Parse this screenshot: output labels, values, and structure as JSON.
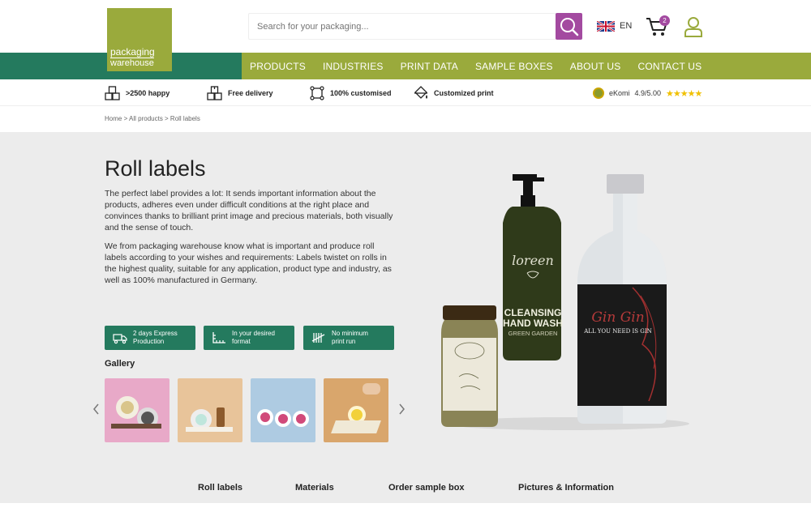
{
  "header": {
    "logo_line1": "packaging",
    "logo_line2": "warehouse",
    "search_placeholder": "Search for your packaging...",
    "language": "EN",
    "cart_count": "2"
  },
  "nav": {
    "items": [
      "PRODUCTS",
      "INDUSTRIES",
      "PRINT DATA",
      "SAMPLE BOXES",
      "ABOUT US",
      "CONTACT US"
    ]
  },
  "benefits": [
    {
      "label": ">2500 happy",
      "icon": "boxes-icon"
    },
    {
      "label": "Free delivery",
      "icon": "delivery-boxes-icon"
    },
    {
      "label": "100% customised",
      "icon": "resize-icon"
    },
    {
      "label": "Customized print",
      "icon": "paint-bucket-icon"
    }
  ],
  "ekomi": {
    "label": "eKomi",
    "rating": "4.9/5.00",
    "stars": "★★★★★"
  },
  "breadcrumb": "Home > All products > Roll labels",
  "main": {
    "title": "Roll labels",
    "paragraph1": "The perfect label provides a lot: It sends important information about the products, adheres even under difficult conditions at the right place and convinces thanks to brilliant print image and precious materials, both visually and the sense of touch.",
    "paragraph2": "We from packaging warehouse know what is important and produce roll labels according to your wishes and requirements: Labels twistet on rolls in the highest quality, suitable for any application, product type and industry, as well as 100% manufactured in Germany.",
    "features": [
      {
        "line1": "2 days Express",
        "line2": "Production"
      },
      {
        "line1": "In your desired",
        "line2": "format"
      },
      {
        "line1": "No minimum",
        "line2": "print run"
      }
    ],
    "gallery_title": "Gallery",
    "product_labels": {
      "soap_brand": "loreen",
      "soap_line1": "CLEANSING",
      "soap_line2": "HAND WASH",
      "soap_line3": "GREEN GARDEN",
      "gin_brand": "Gin Gin",
      "gin_tagline": "ALL YOU NEED IS GIN"
    }
  },
  "tabs": [
    "Roll labels",
    "Materials",
    "Order sample box",
    "Pictures & Information"
  ],
  "colors": {
    "brand_green": "#247a5e",
    "brand_olive": "#9aaa3c",
    "accent_purple": "#a34aa0"
  }
}
